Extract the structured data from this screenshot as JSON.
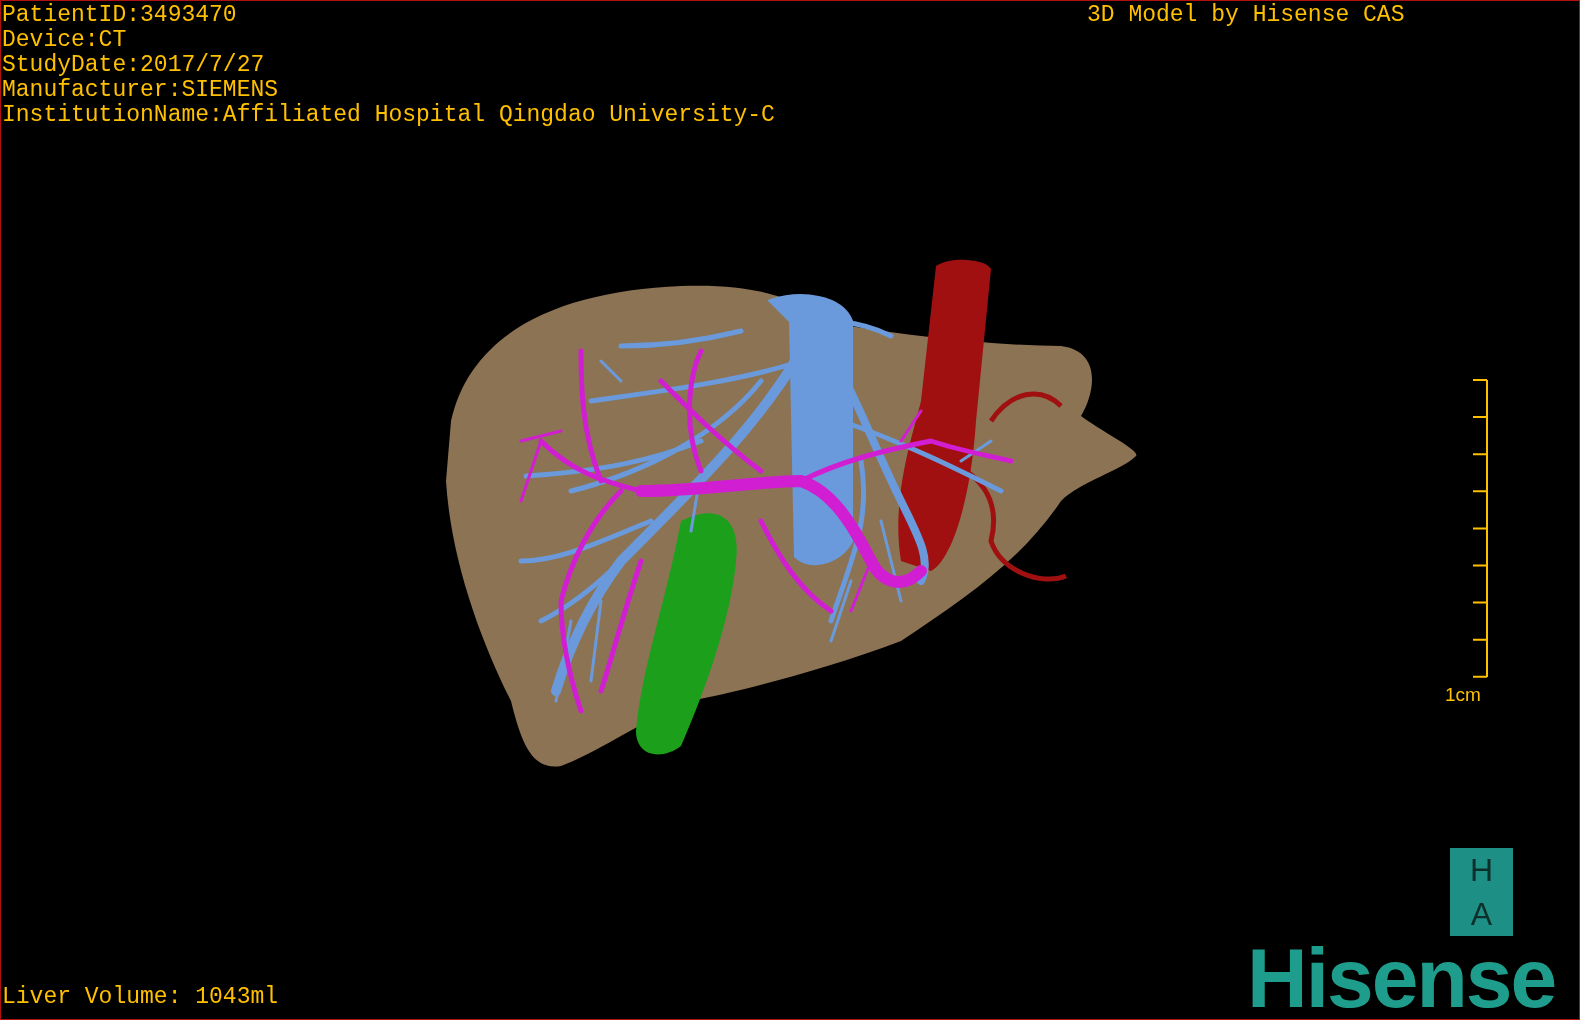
{
  "info_lines": [
    "PatientID:3493470",
    "Device:CT",
    "StudyDate:2017/7/27",
    "Manufacturer:SIEMENS",
    "InstitutionName:Affiliated Hospital Qingdao University-C"
  ],
  "title": "3D Model by Hisense CAS",
  "scale": {
    "label": "1cm"
  },
  "orientation": [
    "H",
    "A"
  ],
  "logo": "Hisense",
  "volume": "Liver Volume: 1043ml"
}
